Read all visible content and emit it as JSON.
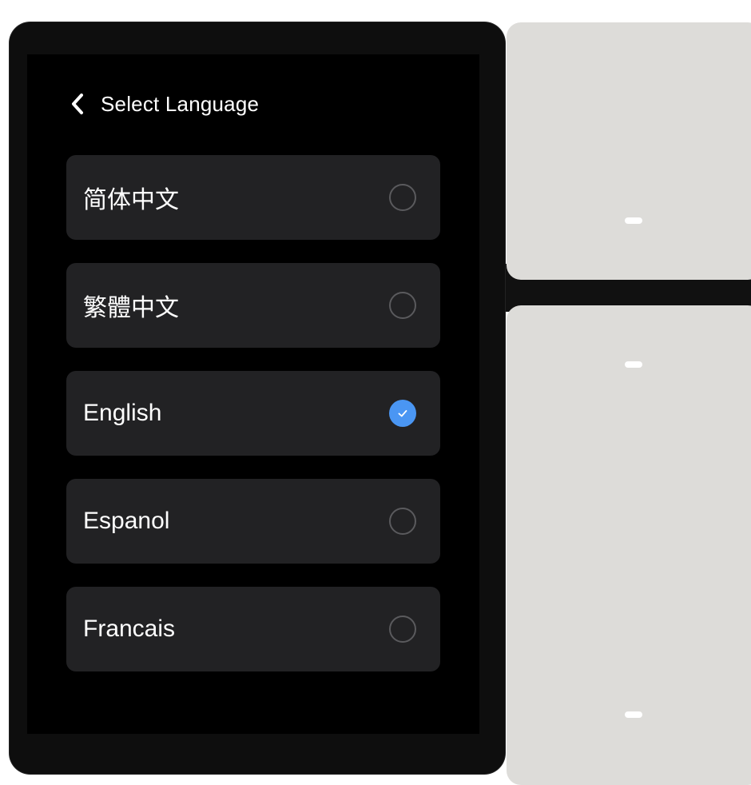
{
  "header": {
    "title": "Select Language",
    "back_icon": "chevron-left-icon"
  },
  "languages": [
    {
      "label": "简体中文",
      "selected": false
    },
    {
      "label": "繁體中文",
      "selected": false
    },
    {
      "label": "English",
      "selected": true
    },
    {
      "label": "Espanol",
      "selected": false
    },
    {
      "label": "Francais",
      "selected": false
    }
  ],
  "colors": {
    "screen_background": "#000000",
    "item_background": "#222224",
    "accent": "#4a96f3",
    "panel": "#dddcd9"
  }
}
